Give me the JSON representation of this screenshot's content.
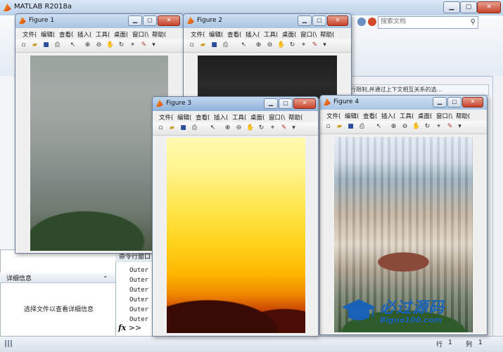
{
  "app": {
    "title": "MATLAB R2018a",
    "search_placeholder": "搜索文档",
    "hint_text": "时率进行限制,并通过上下文相互关系的选...",
    "status_row_label": "行",
    "status_row": "1",
    "status_col_label": "列",
    "status_col": "1"
  },
  "details_panel": {
    "header": "详细信息",
    "message": "选择文件以查看详细信息"
  },
  "command_window": {
    "header": "命令行窗口",
    "lines": [
      "Outer",
      "Outer",
      "Outer",
      "Outer",
      "Outer",
      "Outer"
    ],
    "prompt": "fx",
    "prompt_arrows": ">>"
  },
  "figure_menu": [
    "文件(",
    "编辑(",
    "查看(",
    "插入(",
    "工具(",
    "桌面(",
    "窗口(\\",
    "帮助("
  ],
  "figures": [
    {
      "title": "Figure 1"
    },
    {
      "title": "Figure 2"
    },
    {
      "title": "Figure 3"
    },
    {
      "title": "Figure 4"
    }
  ],
  "watermark": {
    "chinese": "必过源码",
    "english": "Biguo100.com"
  },
  "colors": {
    "accent": "#1a62b8",
    "close_button": "#c6432b"
  }
}
